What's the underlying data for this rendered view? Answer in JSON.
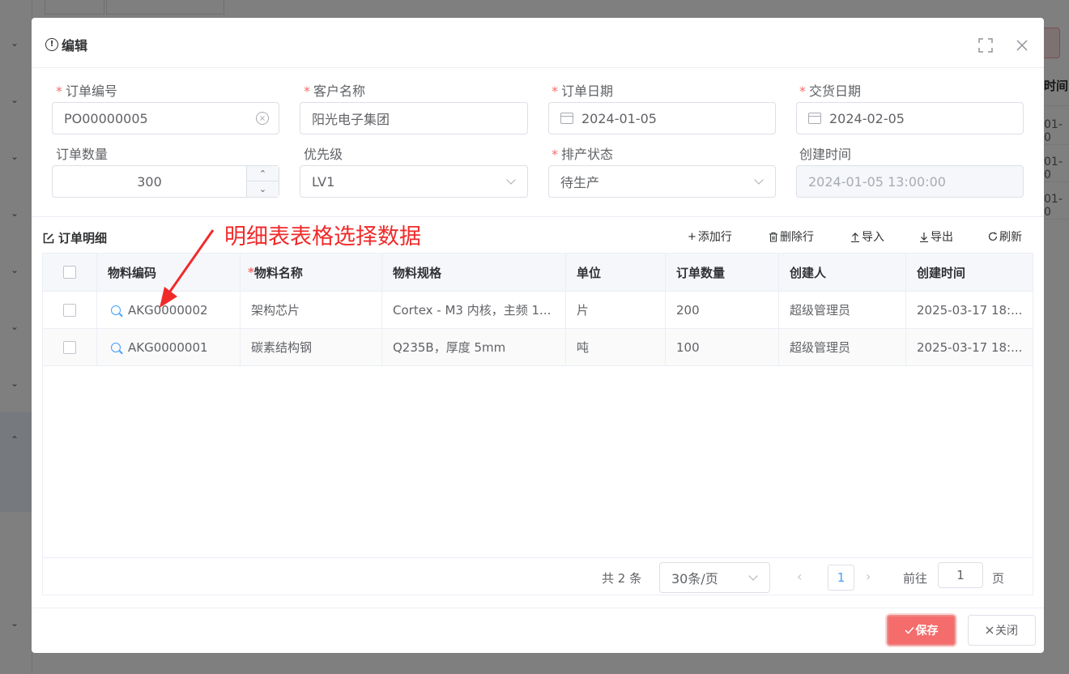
{
  "dialog": {
    "title": "编辑"
  },
  "form": {
    "order_no": {
      "label": "订单编号",
      "value": "PO00000005"
    },
    "customer": {
      "label": "客户名称",
      "value": "阳光电子集团"
    },
    "order_date": {
      "label": "订单日期",
      "value": "2024-01-05"
    },
    "delivery_date": {
      "label": "交货日期",
      "value": "2024-02-05"
    },
    "quantity": {
      "label": "订单数量",
      "value": "300"
    },
    "priority": {
      "label": "优先级",
      "value": "LV1"
    },
    "schedule_status": {
      "label": "排产状态",
      "value": "待生产"
    },
    "created_at": {
      "label": "创建时间",
      "value": "2024-01-05 13:00:00"
    }
  },
  "detail": {
    "title": "订单明细",
    "annotation": "明细表表格选择数据",
    "toolbar": {
      "add_row": "添加行",
      "delete_row": "删除行",
      "import": "导入",
      "export": "导出",
      "refresh": "刷新"
    },
    "columns": [
      "物料编码",
      "物料名称",
      "物料规格",
      "单位",
      "订单数量",
      "创建人",
      "创建时间"
    ],
    "rows": [
      [
        "AKG0000002",
        "架构芯片",
        "Cortex - M3 内核，主频 1...",
        "片",
        "200",
        "超级管理员",
        "2025-03-17 18:..."
      ],
      [
        "AKG0000001",
        "碳素结构钢",
        "Q235B，厚度 5mm",
        "吨",
        "100",
        "超级管理员",
        "2025-03-17 18:..."
      ]
    ]
  },
  "pagination": {
    "total": "共 2 条",
    "page_size": "30条/页",
    "current_page": "1",
    "goto_label": "前往",
    "goto_value": "1",
    "goto_suffix": "页"
  },
  "footer": {
    "save_label": "保存",
    "close_label": "关闭"
  },
  "background": {
    "column_header": "时间",
    "cells": [
      "01-0",
      "01-0",
      "01-0"
    ]
  },
  "colors": {
    "primary": "#409eff",
    "danger": "#f56c6c",
    "annotation": "#f02a2a"
  }
}
